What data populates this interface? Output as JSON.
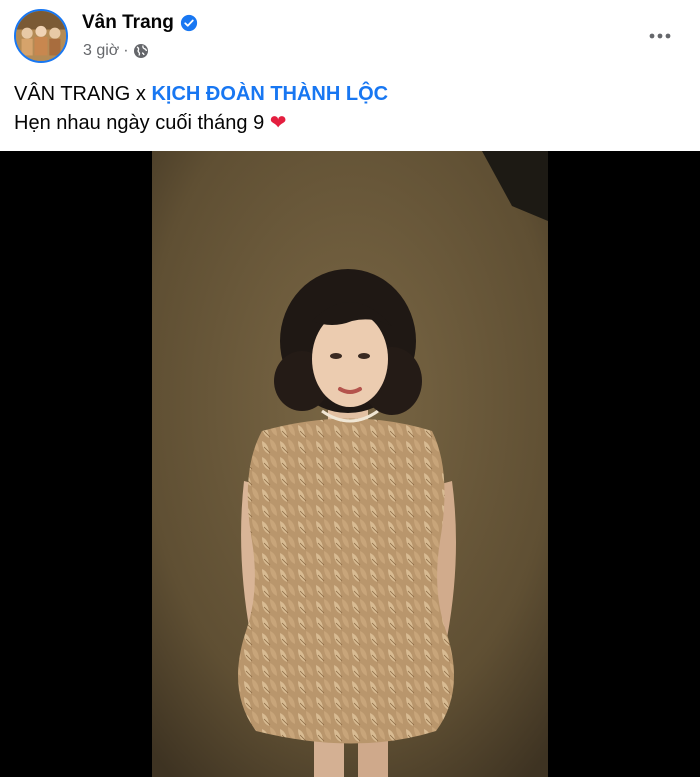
{
  "post": {
    "author": "Vân Trang",
    "time": "3 giờ",
    "separator": "·",
    "text_prefix": "VÂN TRANG x ",
    "mention": "KỊCH ĐOÀN THÀNH LỘC",
    "line2": "Hẹn nhau ngày cuối tháng 9 "
  },
  "icons": {
    "verified": "verified-badge-icon",
    "privacy": "globe-icon",
    "more": "more-options-icon",
    "heart": "red-heart-emoji"
  },
  "colors": {
    "accent": "#1877f2",
    "meta": "#65676b",
    "heart": "#e41e3f",
    "backdrop": "#6b5a3a"
  }
}
